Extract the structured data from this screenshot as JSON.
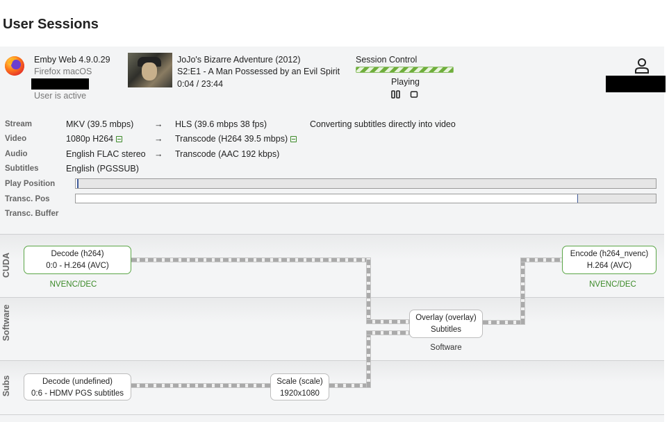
{
  "page_title": "User Sessions",
  "session": {
    "client": "Emby Web 4.9.0.29",
    "device": "Firefox macOS",
    "user_status": "User is active",
    "item_title": "JoJo's Bizarre Adventure (2012)",
    "episode": "S2:E1 - A Man Possessed by an Evil Spirit",
    "time": "0:04 / 23:44",
    "control_label": "Session Control",
    "play_state": "Playing",
    "arrow": "→",
    "stream": {
      "label": "Stream",
      "source": "MKV (39.5 mbps)",
      "target": "HLS (39.6 mbps 38 fps)",
      "note": "Converting subtitles directly into video"
    },
    "video": {
      "label": "Video",
      "source": "1080p H264",
      "target": "Transcode (H264 39.5 mbps)"
    },
    "audio": {
      "label": "Audio",
      "source": "English FLAC stereo",
      "target": "Transcode (AAC 192 kbps)"
    },
    "subtitles": {
      "label": "Subtitles",
      "source": "English (PGSSUB)"
    },
    "play_position": {
      "label": "Play Position",
      "progress": 0.0028
    },
    "transc_pos": {
      "label": "Transc. Pos",
      "progress": 0.865
    },
    "transc_buffer": {
      "label": "Transc. Buffer"
    }
  },
  "pipeline": {
    "lanes": [
      "CUDA",
      "Software",
      "Subs"
    ],
    "decode_h264": {
      "title": "Decode (h264)",
      "detail": "0:0 - H.264 (AVC)",
      "caption": "NVENC/DEC"
    },
    "encode": {
      "title": "Encode (h264_nvenc)",
      "detail": "H.264 (AVC)",
      "caption": "NVENC/DEC"
    },
    "overlay": {
      "title": "Overlay (overlay)",
      "detail": "Subtitles",
      "caption": "Software"
    },
    "decode_subs": {
      "title": "Decode (undefined)",
      "detail": "0:6 - HDMV PGS subtitles"
    },
    "scale": {
      "title": "Scale (scale)",
      "detail": "1920x1080"
    }
  },
  "colors": {
    "accent_green": "#3c8a28",
    "progress_green": "#6fae3c",
    "position_marker": "#3e5a9a"
  },
  "icons": [
    "firefox-icon",
    "user-icon",
    "pause-icon",
    "stop-icon",
    "subtitle-icon"
  ]
}
